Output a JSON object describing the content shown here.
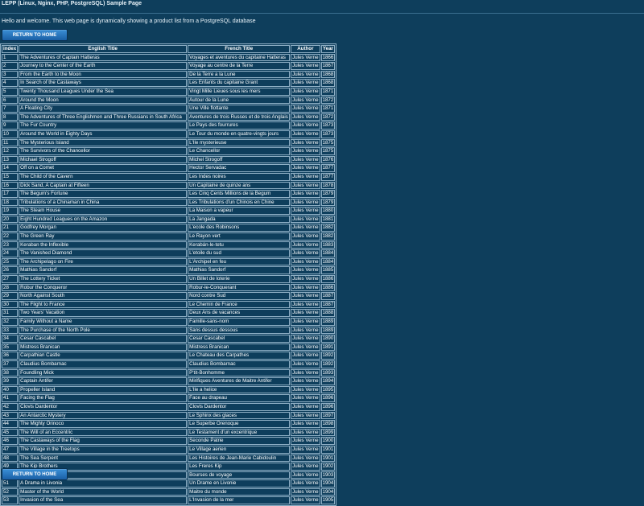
{
  "header": {
    "title": "LEPP (Linux, Nginx, PHP, PostgreSQL) Sample Page",
    "welcome": "Hello and welcome. This web page is dynamically showing a product list from a PostgreSQL database"
  },
  "buttons": {
    "return_home": "RETURN TO HOME"
  },
  "table": {
    "headers": [
      "index",
      "English Title",
      "French Title",
      "Author",
      "Year"
    ],
    "rows": [
      [
        "1",
        "The Adventures of Captain Hatteras",
        "Voyages et aventures du capitaine Hatteras",
        "Jules Verne",
        "1866"
      ],
      [
        "2",
        "Journey to the Center of the Earth",
        "Voyage au centre de la Terre",
        "Jules Verne",
        "1867"
      ],
      [
        "3",
        "From the Earth to the Moon",
        "De la Terre a la Lune",
        "Jules Verne",
        "1868"
      ],
      [
        "4",
        "In Search of the Castaways",
        "Les Enfants du capitaine Grant",
        "Jules Verne",
        "1868"
      ],
      [
        "5",
        "Twenty Thousand Leagues Under the Sea",
        "Vingt Mille Lieues sous les mers",
        "Jules Verne",
        "1871"
      ],
      [
        "6",
        "Around the Moon",
        "Autour de la Lune",
        "Jules Verne",
        "1872"
      ],
      [
        "7",
        "A Floating City",
        "Une Ville flottante",
        "Jules Verne",
        "1871"
      ],
      [
        "8",
        "The Adventures of Three Englishmen and Three Russians in South Africa",
        "Aventures de trois Russes et de trois Anglais",
        "Jules Verne",
        "1872"
      ],
      [
        "9",
        "The Fur Country",
        "Le Pays des fourrures",
        "Jules Verne",
        "1873"
      ],
      [
        "10",
        "Around the World in Eighty Days",
        "Le Tour du monde en quatre-vingts jours",
        "Jules Verne",
        "1873"
      ],
      [
        "11",
        "The Mysterious Island",
        "L'Ile mysterieuse",
        "Jules Verne",
        "1875"
      ],
      [
        "12",
        "The Survivors of the Chancellor",
        "Le Chancellor",
        "Jules Verne",
        "1875"
      ],
      [
        "13",
        "Michael Strogoff",
        "Michel Strogoff",
        "Jules Verne",
        "1876"
      ],
      [
        "14",
        "Off on a Comet",
        "Hector Servadac",
        "Jules Verne",
        "1877"
      ],
      [
        "15",
        "The Child of the Cavern",
        "Les Indes noires",
        "Jules Verne",
        "1877"
      ],
      [
        "16",
        "Dick Sand, A Captain at Fifteen",
        "Un Capitaine de quinze ans",
        "Jules Verne",
        "1878"
      ],
      [
        "17",
        "The Begum's Fortune",
        "Les Cinq Cents Millions de la Begum",
        "Jules Verne",
        "1879"
      ],
      [
        "18",
        "Tribulations of a Chinaman in China",
        "Les Tribulations d'un Chinois en Chine",
        "Jules Verne",
        "1879"
      ],
      [
        "19",
        "The Steam House",
        "La Maison a vapeur",
        "Jules Verne",
        "1880"
      ],
      [
        "20",
        "Eight Hundred Leagues on the Amazon",
        "La Jangada",
        "Jules Verne",
        "1881"
      ],
      [
        "21",
        "Godfrey Morgan",
        "L'ecole des Robinsons",
        "Jules Verne",
        "1882"
      ],
      [
        "22",
        "The Green Ray",
        "Le Rayon vert",
        "Jules Verne",
        "1882"
      ],
      [
        "23",
        "Keraban the Inflexible",
        "Kerabán-le-tetu",
        "Jules Verne",
        "1883"
      ],
      [
        "24",
        "The Vanished Diamond",
        "L'etoile du sud",
        "Jules Verne",
        "1884"
      ],
      [
        "25",
        "The Archipelago on Fire",
        "L'Archipel en feu",
        "Jules Verne",
        "1884"
      ],
      [
        "26",
        "Mathias Sandorf",
        "Mathias Sandorf",
        "Jules Verne",
        "1885"
      ],
      [
        "27",
        "The Lottery Ticket",
        "Un Billet de loterie",
        "Jules Verne",
        "1886"
      ],
      [
        "28",
        "Robur the Conqueror",
        "Robur-le-Conquerant",
        "Jules Verne",
        "1886"
      ],
      [
        "29",
        "North Against South",
        "Nord contre Sud",
        "Jules Verne",
        "1887"
      ],
      [
        "30",
        "The Flight to France",
        "Le Chemin de France",
        "Jules Verne",
        "1887"
      ],
      [
        "31",
        "Two Years' Vacation",
        "Deux Ans de vacances",
        "Jules Verne",
        "1888"
      ],
      [
        "32",
        "Family Without a Name",
        "Famille-sans-nom",
        "Jules Verne",
        "1889"
      ],
      [
        "33",
        "The Purchase of the North Pole",
        "Sans dessus dessous",
        "Jules Verne",
        "1889"
      ],
      [
        "34",
        "Cesar Cascabel",
        "Cesar Cascabel",
        "Jules Verne",
        "1890"
      ],
      [
        "35",
        "Mistress Branican",
        "Mistress Branican",
        "Jules Verne",
        "1891"
      ],
      [
        "36",
        "Carpathian Castle",
        "Le Chateau des Carpathes",
        "Jules Verne",
        "1892"
      ],
      [
        "37",
        "Claudius Bombarnac",
        "Claudius Bombarnac",
        "Jules Verne",
        "1892"
      ],
      [
        "38",
        "Foundling Mick",
        "P'tit-Bonhomme",
        "Jules Verne",
        "1893"
      ],
      [
        "39",
        "Captain Antifer",
        "Mirifiques Aventures de Maitre Antifer",
        "Jules Verne",
        "1894"
      ],
      [
        "40",
        "Propeller Island",
        "L'Ile a helice",
        "Jules Verne",
        "1895"
      ],
      [
        "41",
        "Facing the Flag",
        "Face au drapeau",
        "Jules Verne",
        "1896"
      ],
      [
        "42",
        "Clovis Dardentor",
        "Clovis Dardentor",
        "Jules Verne",
        "1896"
      ],
      [
        "43",
        "An Antarctic Mystery",
        "Le Sphinx des glaces",
        "Jules Verne",
        "1897"
      ],
      [
        "44",
        "The Mighty Orinoco",
        "Le Superbe Orenoque",
        "Jules Verne",
        "1898"
      ],
      [
        "45",
        "The Will of an Eccentric",
        "Le Testament d'un excentrique",
        "Jules Verne",
        "1899"
      ],
      [
        "46",
        "The Castaways of the Flag",
        "Seconde Patrie",
        "Jules Verne",
        "1900"
      ],
      [
        "47",
        "The Village in the Treetops",
        "Le Village aerien",
        "Jules Verne",
        "1901"
      ],
      [
        "48",
        "The Sea Serpent",
        "Les Histoires de Jean-Marie Cabidoulin",
        "Jules Verne",
        "1901"
      ],
      [
        "49",
        "The Kip Brothers",
        "Les Freres Kip",
        "Jules Verne",
        "1902"
      ],
      [
        "50",
        "Travel Scholarships",
        "Bourses de voyage",
        "Jules Verne",
        "1903"
      ],
      [
        "51",
        "A Drama in Livonia",
        "Un Drame en Livonie",
        "Jules Verne",
        "1904"
      ],
      [
        "52",
        "Master of the World",
        "Maitre du monde",
        "Jules Verne",
        "1904"
      ],
      [
        "53",
        "Invasion of the Sea",
        "L'Invasion de la mer",
        "Jules Verne",
        "1905"
      ]
    ]
  }
}
